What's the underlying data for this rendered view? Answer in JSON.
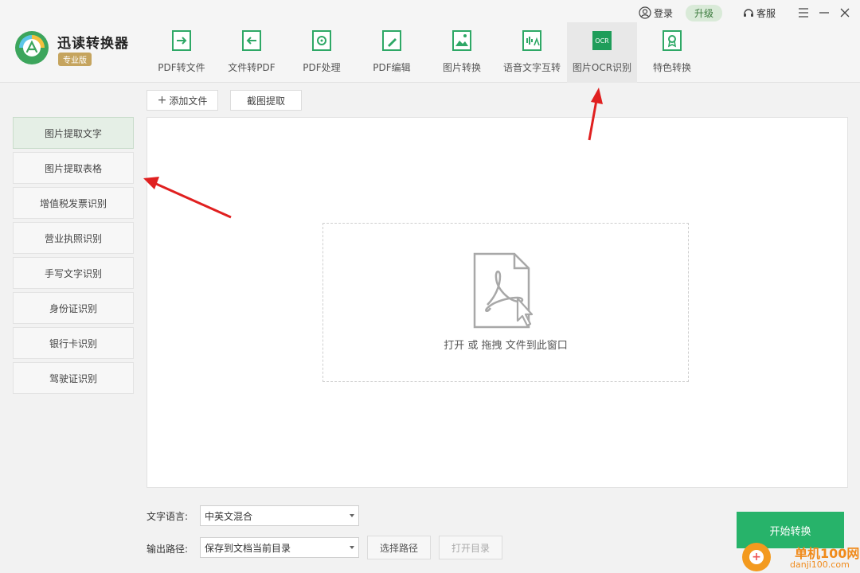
{
  "app": {
    "title": "迅读转换器",
    "badge": "专业版"
  },
  "topbar": {
    "login": "登录",
    "upgrade": "升级",
    "service": "客服"
  },
  "tabs": [
    {
      "label": "PDF转文件",
      "icon": "pdf-convert-icon"
    },
    {
      "label": "文件转PDF",
      "icon": "file-to-pdf-icon"
    },
    {
      "label": "PDF处理",
      "icon": "pdf-process-icon"
    },
    {
      "label": "PDF编辑",
      "icon": "pdf-edit-icon"
    },
    {
      "label": "图片转换",
      "icon": "image-convert-icon"
    },
    {
      "label": "语音文字互转",
      "icon": "voice-text-icon"
    },
    {
      "label": "图片OCR识别",
      "icon": "ocr-icon",
      "badge": "OCR"
    },
    {
      "label": "特色转换",
      "icon": "special-convert-icon"
    }
  ],
  "sidebar": {
    "items": [
      {
        "label": "图片提取文字"
      },
      {
        "label": "图片提取表格"
      },
      {
        "label": "增值税发票识别"
      },
      {
        "label": "营业执照识别"
      },
      {
        "label": "手写文字识别"
      },
      {
        "label": "身份证识别"
      },
      {
        "label": "银行卡识别"
      },
      {
        "label": "驾驶证识别"
      }
    ]
  },
  "toolbar": {
    "add_file": "添加文件",
    "crop_extract": "截图提取"
  },
  "dropzone": {
    "text": "打开 或 拖拽 文件到此窗口"
  },
  "footer": {
    "language_label": "文字语言:",
    "language_value": "中英文混合",
    "output_label": "输出路径:",
    "output_value": "保存到文档当前目录",
    "choose_path": "选择路径",
    "open_dir": "打开目录",
    "start": "开始转换"
  },
  "watermark": {
    "site": "单机100网",
    "url": "danji100.com"
  },
  "colors": {
    "accent": "#27b36a",
    "active_side": "#e5efe6",
    "arrow": "#e02020",
    "badge": "#c5a45e"
  }
}
